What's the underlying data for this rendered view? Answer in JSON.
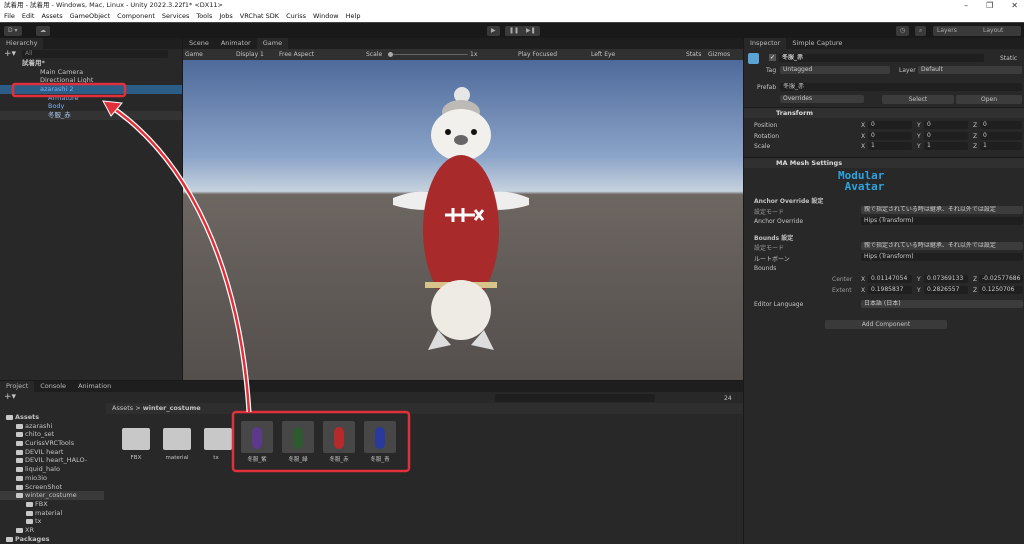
{
  "window": {
    "title": "試着用 - 試着用 - Windows, Mac, Linux - Unity 2022.3.22f1* <DX11>",
    "minimize": "–",
    "restore": "❐",
    "close": "✕"
  },
  "menu": [
    "File",
    "Edit",
    "Assets",
    "GameObject",
    "Component",
    "Services",
    "Tools",
    "Jobs",
    "VRChat SDK",
    "Curiss",
    "Window",
    "Help"
  ],
  "toolbar": {
    "account": "D ▾",
    "play": "▶",
    "pause": "❚❚",
    "step": "▶❚",
    "layers": "Layers",
    "layout": "Layout"
  },
  "hierarchy": {
    "tab": "Hierarchy",
    "search_placeholder": "All",
    "scene": "試着用*",
    "items": [
      "Main Camera",
      "Directional Light",
      "azarashi 2",
      "Armature",
      "Body",
      "冬服_赤"
    ]
  },
  "game": {
    "tabs": [
      "Scene",
      "Animator",
      "Game"
    ],
    "game_dd": "Game",
    "display": "Display 1",
    "aspect": "Free Aspect",
    "scale_label": "Scale",
    "scale_value": "1x",
    "play_focused": "Play Focused",
    "eye": "Left Eye",
    "stats": "Stats",
    "gizmos": "Gizmos"
  },
  "inspector": {
    "tabs": [
      "Inspector",
      "Simple Capture"
    ],
    "object_name": "冬服_赤",
    "static": "Static",
    "tag_label": "Tag",
    "tag": "Untagged",
    "layer_label": "Layer",
    "layer": "Default",
    "prefab_label": "Prefab",
    "prefab": "冬服_赤",
    "overrides": "Overrides",
    "select": "Select",
    "open": "Open",
    "transform": {
      "title": "Transform",
      "rows": [
        {
          "label": "Position",
          "x": "0",
          "y": "0",
          "z": "0"
        },
        {
          "label": "Rotation",
          "x": "0",
          "y": "0",
          "z": "0"
        },
        {
          "label": "Scale",
          "x": "1",
          "y": "1",
          "z": "1"
        }
      ]
    },
    "ma": {
      "title": "MA Mesh Settings",
      "logo": "Modular Avatar",
      "anchor_header": "Anchor Override 設定",
      "mode_label": "設定モード",
      "mode_value": "親で指定されている時は継承、それ以外では設定",
      "anchor_label": "Anchor Override",
      "anchor_value": "Hips (Transform)",
      "bounds_header": "Bounds 設定",
      "mode_label2": "設定モード",
      "mode_value2": "親で指定されている時は継承、それ以外では設定",
      "root_label": "ルートボーン",
      "root_value": "Hips (Transform)",
      "bounds_label": "Bounds",
      "center_label": "Center",
      "center": {
        "x": "0.01147054",
        "y": "0.07369133",
        "z": "-0.02577686"
      },
      "extent_label": "Extent",
      "extent": {
        "x": "0.1985837",
        "y": "0.2826557",
        "z": "0.1250706"
      },
      "lang_label": "Editor Language",
      "lang_value": "日本語 (日本)"
    },
    "add_component": "Add Component"
  },
  "project": {
    "tabs": [
      "Project",
      "Console",
      "Animation"
    ],
    "tree": [
      "Assets",
      "azarashi",
      "chito_set",
      "CurissVRCTools",
      "DEVIL heart",
      "DEVIL heart_HALO-",
      "liquid_halo",
      "mio3io",
      "ScreenShot",
      "winter_costume",
      "FBX",
      "material",
      "tx",
      "XR",
      "Packages"
    ],
    "breadcrumb": [
      "Assets",
      "winter_costume"
    ],
    "folders": [
      "FBX",
      "material",
      "tx"
    ],
    "assets": [
      {
        "name": "冬服_紫",
        "color": "#5b3a8c"
      },
      {
        "name": "冬服_緑",
        "color": "#2f5a30"
      },
      {
        "name": "冬服_赤",
        "color": "#b52a2a"
      },
      {
        "name": "冬服_青",
        "color": "#2a3a9c"
      }
    ],
    "count": "24"
  },
  "annotation_color": "#e0303a"
}
